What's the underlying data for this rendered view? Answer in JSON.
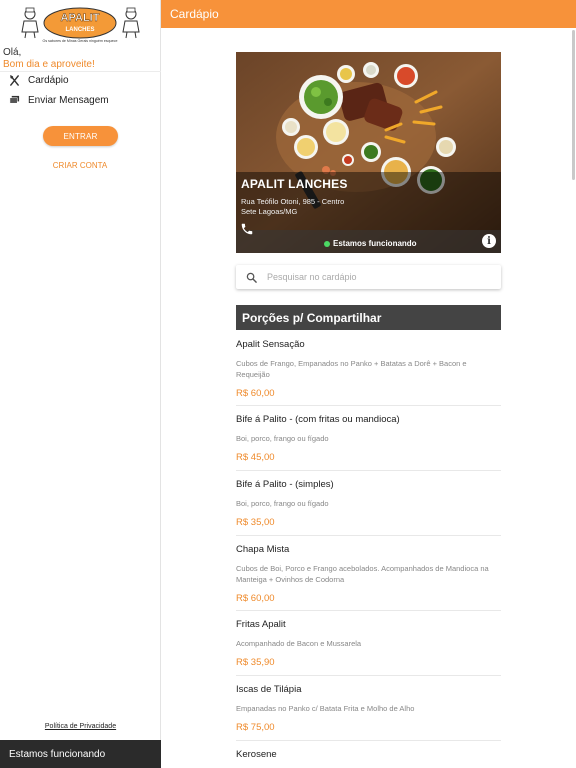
{
  "sidebar": {
    "logo": {
      "name": "APALIT",
      "sub": "LANCHES",
      "tagline": "Os sabores de Minas Gerais ninguém esquece"
    },
    "greeting": "Olá,",
    "greeting_sub": "Bom dia e aproveite!",
    "nav": [
      {
        "label": "Cardápio",
        "icon": "utensils-icon"
      },
      {
        "label": "Enviar Mensagem",
        "icon": "messages-icon"
      }
    ],
    "enter_label": "ENTRAR",
    "create_label": "CRIAR CONTA",
    "privacy_label": "Política de Privacidade",
    "status_label": "Estamos funcionando"
  },
  "header": {
    "title": "Cardápio"
  },
  "restaurant": {
    "name": "APALIT LANCHES",
    "address_line1": "Rua Teófilo Otoni, 985 - Centro",
    "address_line2": "Sete Lagoas/MG",
    "status": "Estamos funcionando"
  },
  "search": {
    "placeholder": "Pesquisar no cardápio"
  },
  "menu": {
    "category": "Porções p/ Compartilhar",
    "items": [
      {
        "name": "Apalit Sensação",
        "description": "Cubos de Frango, Empanados no Panko + Batatas a Dorê + Bacon e Requeijão",
        "price": "R$ 60,00"
      },
      {
        "name": "Bife á Palito - (com fritas ou mandioca)",
        "description": "Boi, porco, frango ou fígado",
        "price": "R$ 45,00"
      },
      {
        "name": "Bife á Palito - (simples)",
        "description": "Boi, porco, frango ou fígado",
        "price": "R$ 35,00"
      },
      {
        "name": "Chapa Mista",
        "description": "Cubos de Boi, Porco e Frango acebolados. Acompanhados de Mandioca na Manteiga + Ovinhos de Codorna",
        "price": "R$ 60,00"
      },
      {
        "name": "Fritas Apalit",
        "description": "Acompanhado de Bacon e Mussarela",
        "price": "R$ 35,90"
      },
      {
        "name": "Iscas de Tilápia",
        "description": "Empanadas no Panko c/ Batata Frita e Molho de Alho",
        "price": "R$ 75,00"
      },
      {
        "name": "Kerosene",
        "description": "",
        "price": ""
      }
    ]
  },
  "colors": {
    "accent": "#f7923a",
    "dark": "#444444",
    "status_green": "#4cd964"
  }
}
